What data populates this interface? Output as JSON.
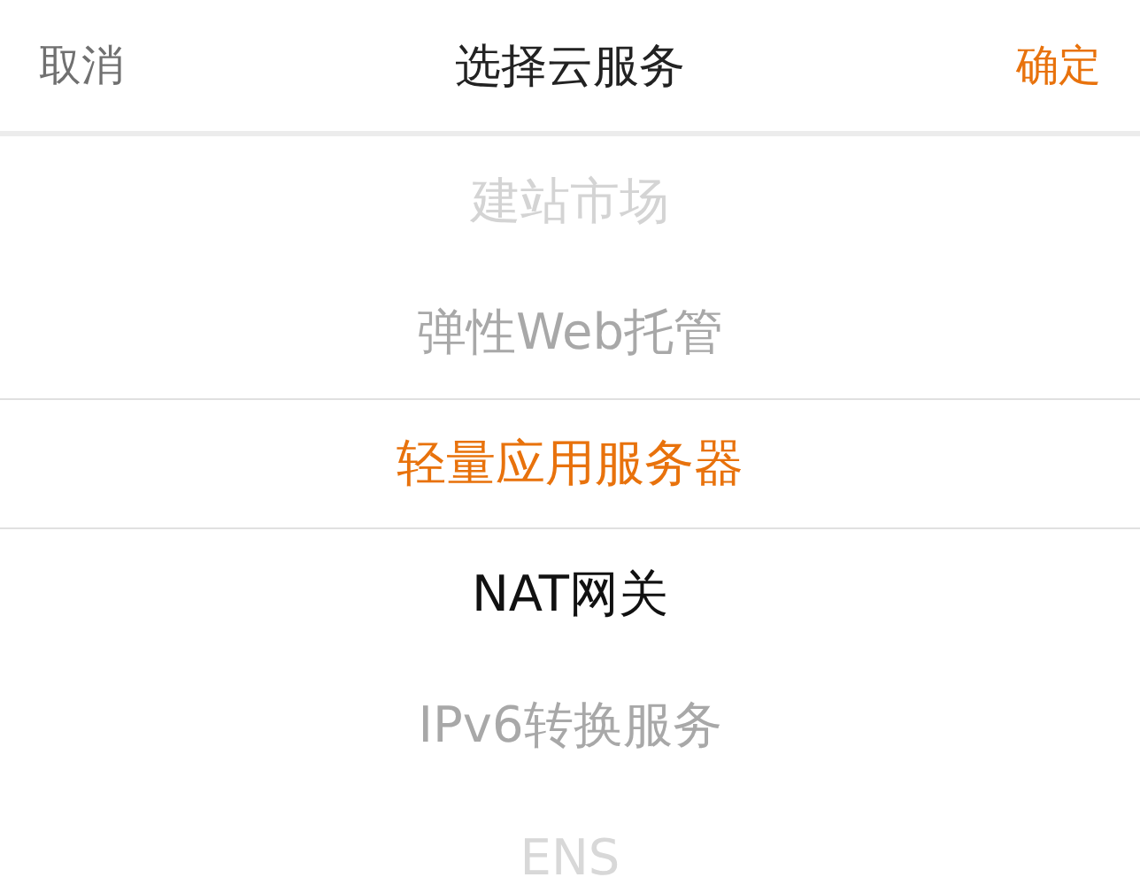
{
  "header": {
    "cancel": "取消",
    "title": "选择云服务",
    "confirm": "确定"
  },
  "options": [
    {
      "label": "建站市场",
      "selected": false,
      "color": "#d4d4d4"
    },
    {
      "label": "弹性Web托管",
      "selected": false,
      "color": "#a8a8a8"
    },
    {
      "label": "轻量应用服务器",
      "selected": true,
      "color": "#e8720c"
    },
    {
      "label": "NAT网关",
      "selected": false,
      "color": "#111111"
    },
    {
      "label": "IPv6转换服务",
      "selected": false,
      "color": "#a8a8a8"
    },
    {
      "label": "ENS",
      "selected": false,
      "color": "#d8d8d8"
    }
  ]
}
